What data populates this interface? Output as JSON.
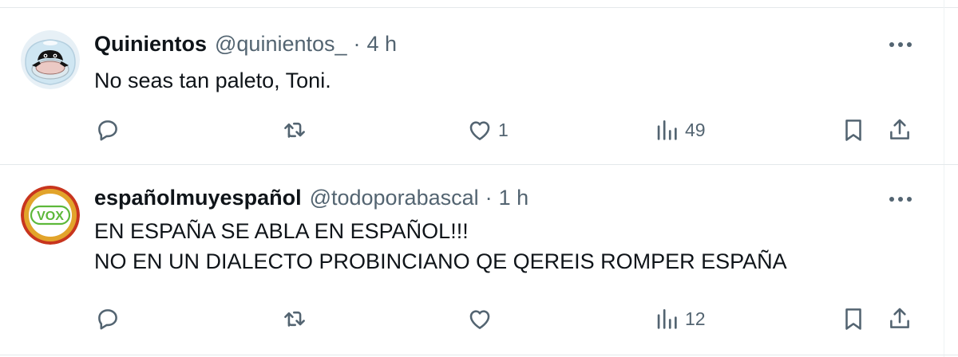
{
  "tweets": [
    {
      "display_name": "Quinientos",
      "handle": "@quinientos_",
      "separator": "·",
      "time": "4 h",
      "lines": [
        "No seas tan paleto, Toni."
      ],
      "avatar": "bowl-character-avatar",
      "replies": "",
      "retweets": "",
      "likes": "1",
      "views": "49"
    },
    {
      "display_name": "españolmuyespañol",
      "handle": "@todoporabascal",
      "separator": "·",
      "time": "1 h",
      "lines": [
        "EN ESPAÑA SE ABLA EN ESPAÑOL!!!",
        "NO EN UN DIALECTO PROBINCIANO QE QEREIS ROMPER ESPAÑA"
      ],
      "avatar": "vox-logo-avatar",
      "avatar_text": "VOX",
      "replies": "",
      "retweets": "",
      "likes": "",
      "views": "12"
    }
  ],
  "icons": {
    "more": "more-horizontal-icon",
    "reply": "reply-icon",
    "retweet": "retweet-icon",
    "like": "heart-icon",
    "views": "views-bar-chart-icon",
    "bookmark": "bookmark-icon",
    "share": "share-icon"
  },
  "colors": {
    "text": "#0f1419",
    "secondary": "#536471",
    "divider": "#e4e8eb",
    "vox_green": "#5db83a",
    "vox_gold": "#e2a42b",
    "vox_red": "#c8351e"
  }
}
